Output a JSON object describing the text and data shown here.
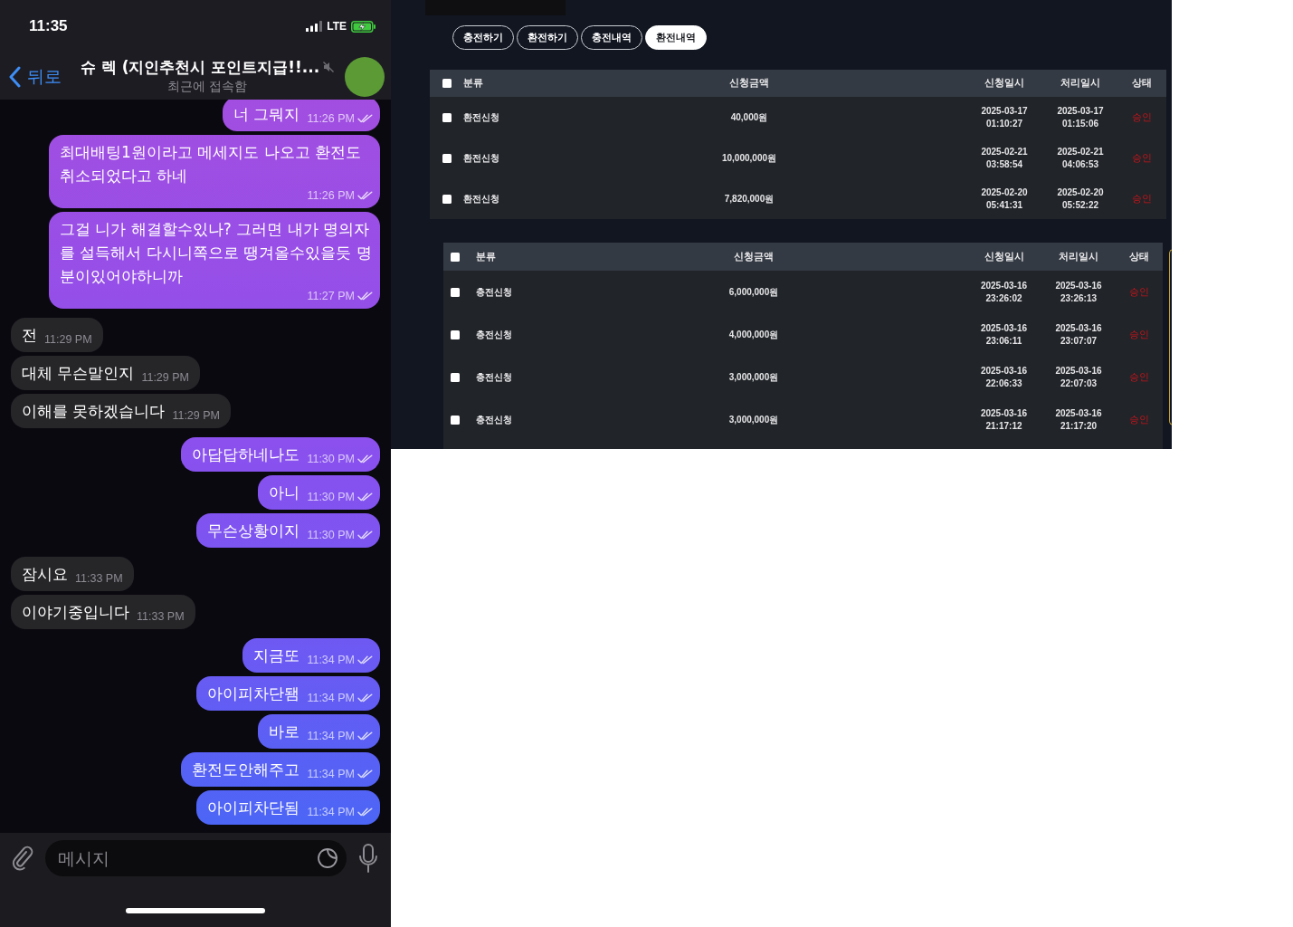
{
  "phone": {
    "status_bar": {
      "time": "11:35",
      "network": "LTE"
    },
    "chat_header": {
      "back_label": "뒤로",
      "title": "슈 렉 (지인추천시 포인트지급!!...",
      "muted": true,
      "subtitle": "최근에 접속함"
    },
    "messages": [
      {
        "kind": "outgoing",
        "text": "너 그뭐지",
        "time": "11:26 PM",
        "read": true
      },
      {
        "kind": "outgoing",
        "text": "최대배팅1원이라고 메세지도 나오고 환전도 취소되었다고 하네",
        "time": "11:26 PM",
        "read": true
      },
      {
        "kind": "outgoing",
        "text": "그걸 니가 해결할수있나? 그러면 내가 명의자를 설득해서 다시니쪽으로 땡겨올수있을듯 명분이있어야하니까",
        "time": "11:27 PM",
        "read": true
      },
      {
        "kind": "incoming",
        "text": "전",
        "time": "11:29 PM"
      },
      {
        "kind": "incoming",
        "text": "대체 무슨말인지",
        "time": "11:29 PM"
      },
      {
        "kind": "incoming",
        "text": "이해를 못하겠습니다",
        "time": "11:29 PM"
      },
      {
        "kind": "outgoing",
        "text": "아답답하네나도",
        "time": "11:30 PM",
        "read": true
      },
      {
        "kind": "outgoing",
        "text": "아니",
        "time": "11:30 PM",
        "read": true
      },
      {
        "kind": "outgoing",
        "text": "무슨상황이지",
        "time": "11:30 PM",
        "read": true
      },
      {
        "kind": "incoming",
        "text": "잠시요",
        "time": "11:33 PM"
      },
      {
        "kind": "incoming",
        "text": "이야기중입니다",
        "time": "11:33 PM"
      },
      {
        "kind": "outgoing",
        "text": "지금또",
        "time": "11:34 PM",
        "read": true
      },
      {
        "kind": "outgoing",
        "text": "아이피차단됌",
        "time": "11:34 PM",
        "read": true
      },
      {
        "kind": "outgoing",
        "text": "바로",
        "time": "11:34 PM",
        "read": true
      },
      {
        "kind": "outgoing",
        "text": "환전도안해주고",
        "time": "11:34 PM",
        "read": true
      },
      {
        "kind": "outgoing",
        "text": "아이피차단됨",
        "time": "11:34 PM",
        "read": true
      }
    ],
    "composer": {
      "placeholder": "메시지"
    }
  },
  "history_panels": [
    {
      "tabs": [
        {
          "label": "충전하기",
          "selected": false
        },
        {
          "label": "환전하기",
          "selected": false
        },
        {
          "label": "충전내역",
          "selected": false
        },
        {
          "label": "환전내역",
          "selected": true
        }
      ],
      "table": {
        "select_all_checked": false,
        "columns": [
          "분류",
          "신청금액",
          "신청일시",
          "처리일시",
          "상태"
        ],
        "rows": [
          {
            "checked": false,
            "category": "환전신청",
            "amount": "40,000원",
            "requested": "2025-03-17 01:10:27",
            "processed": "2025-03-17 01:15:06",
            "status": "승인"
          },
          {
            "checked": false,
            "category": "환전신청",
            "amount": "10,000,000원",
            "requested": "2025-02-21 03:58:54",
            "processed": "2025-02-21 04:06:53",
            "status": "승인"
          },
          {
            "checked": false,
            "category": "환전신청",
            "amount": "7,820,000원",
            "requested": "2025-02-20 05:41:31",
            "processed": "2025-02-20 05:52:22",
            "status": "승인"
          }
        ]
      }
    },
    {
      "table": {
        "select_all_checked": false,
        "columns": [
          "분류",
          "신청금액",
          "신청일시",
          "처리일시",
          "상태"
        ],
        "rows": [
          {
            "checked": false,
            "category": "충전신청",
            "amount": "6,000,000원",
            "requested": "2025-03-16 23:26:02",
            "processed": "2025-03-16 23:26:13",
            "status": "승인"
          },
          {
            "checked": false,
            "category": "충전신청",
            "amount": "4,000,000원",
            "requested": "2025-03-16 23:06:11",
            "processed": "2025-03-16 23:07:07",
            "status": "승인"
          },
          {
            "checked": false,
            "category": "충전신청",
            "amount": "3,000,000원",
            "requested": "2025-03-16 22:06:33",
            "processed": "2025-03-16 22:07:03",
            "status": "승인"
          },
          {
            "checked": false,
            "category": "충전신청",
            "amount": "3,000,000원",
            "requested": "2025-03-16 21:17:12",
            "processed": "2025-03-16 21:17:20",
            "status": "승인"
          }
        ]
      }
    }
  ]
}
